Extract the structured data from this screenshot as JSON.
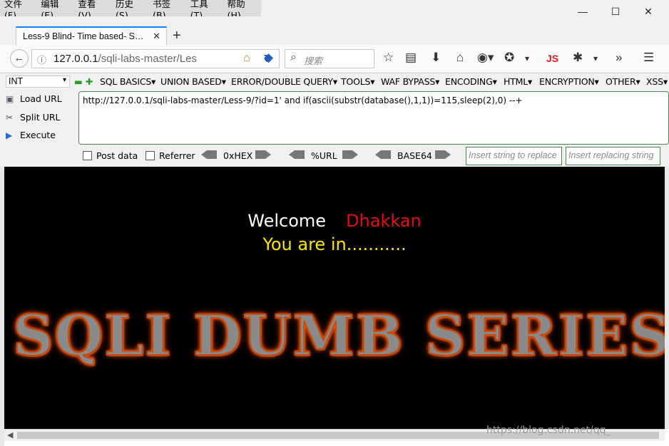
{
  "menubar": {
    "items": [
      "文件(F)",
      "编辑(E)",
      "查看(V)",
      "历史(S)",
      "书签(B)",
      "工具(T)",
      "帮助(H)"
    ]
  },
  "window": {
    "minimize": "—",
    "maximize": "☐",
    "close": "✕"
  },
  "tab": {
    "title": "Less-9 Blind- Time based- S…",
    "close": "✕",
    "new_tab": "+"
  },
  "navbar": {
    "url_host": "127.0.0.1",
    "url_path": "/sqli-labs-master/Les",
    "search_placeholder": "搜索",
    "js_label": "JS",
    "overflow": "»"
  },
  "hackbar": {
    "type_select": "INT",
    "menus": [
      "SQL BASICS▾",
      "UNION BASED▾",
      "ERROR/DOUBLE QUERY▾",
      "TOOLS▾",
      "WAF BYPASS▾",
      "ENCODING▾",
      "HTML▾",
      "ENCRYPTION▾",
      "OTHER▾",
      "XSS▾"
    ],
    "actions": [
      "Load URL",
      "Split URL",
      "Execute"
    ],
    "url_value": "http://127.0.0.1/sqli-labs-master/Less-9/?id=1' and if(ascii(substr(database(),1,1))=115,sleep(2),0) --+",
    "post_data": "Post data",
    "referrer": "Referrer",
    "hex": "0xHEX",
    "url_enc": "%URL",
    "base64": "BASE64",
    "insert_placeholder": "Insert string to replace",
    "replacing_placeholder": "Insert replacing string"
  },
  "page": {
    "welcome": "Welcome",
    "name": "Dhakkan",
    "status": "You are in...........",
    "banner": "SQLI DUMB SERIES-"
  },
  "watermark": "https://blog.csdn.net/qq_",
  "colors": {
    "accent": "#0a84ff",
    "welcome": "#ffffff",
    "name": "#e01010",
    "status": "#ffe600",
    "content_bg": "#000000"
  }
}
